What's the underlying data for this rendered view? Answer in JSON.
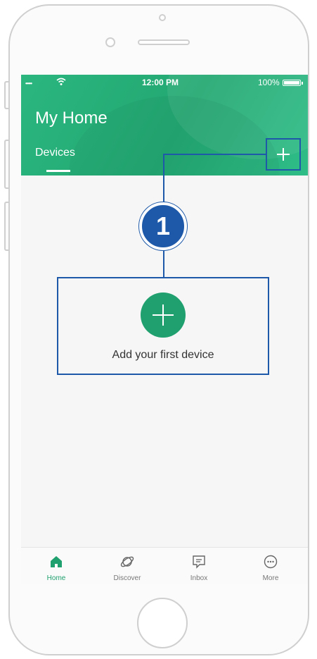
{
  "status_bar": {
    "signal": "•••••",
    "time": "12:00 PM",
    "battery": "100%"
  },
  "header": {
    "title": "My Home",
    "tab_label": "Devices",
    "add_icon": "plus-icon"
  },
  "main": {
    "add_device_label": "Add your first device",
    "add_icon": "plus-icon"
  },
  "bottom_nav": {
    "items": [
      {
        "label": "Home",
        "icon": "home-icon",
        "active": true
      },
      {
        "label": "Discover",
        "icon": "planet-icon",
        "active": false
      },
      {
        "label": "Inbox",
        "icon": "message-icon",
        "active": false
      },
      {
        "label": "More",
        "icon": "ellipsis-circle-icon",
        "active": false
      }
    ]
  },
  "annotation": {
    "step_number": "1",
    "color": "#1d59a8"
  },
  "colors": {
    "brand_green": "#23a872",
    "active_green": "#1fa06e",
    "annotation_blue": "#1d59a8"
  }
}
